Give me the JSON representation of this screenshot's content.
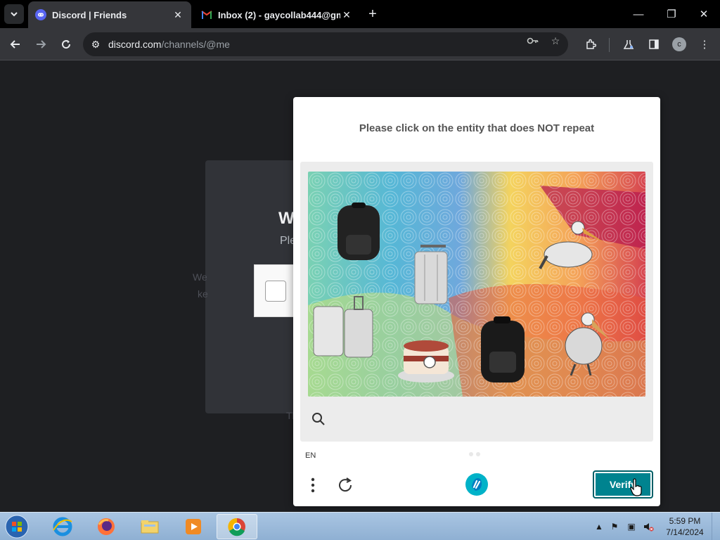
{
  "browser": {
    "tabs": [
      {
        "title": "Discord | Friends",
        "icon": "discord-icon",
        "active": true
      },
      {
        "title": "Inbox (2) - gaycollab444@gma",
        "icon": "gmail-icon",
        "active": false
      }
    ],
    "url": {
      "host": "discord.com",
      "path": "/channels/@me"
    },
    "profile_initial": "c"
  },
  "discord_bg": {
    "heading": "W",
    "subtext": "Ple",
    "left_line1": "We",
    "left_line2": "ke",
    "bottom_text": "Th"
  },
  "captcha": {
    "prompt": "Please click on the entity that does NOT repeat",
    "language": "EN",
    "verify_label": "Verify",
    "image_objects": [
      "backpack",
      "suitcase",
      "pelican",
      "suitcase",
      "cake",
      "backpack",
      "pelican"
    ],
    "colors": {
      "verify": "#00838f",
      "logo": "#00b2c8"
    }
  },
  "taskbar": {
    "apps": [
      "internet-explorer-icon",
      "firefox-icon",
      "file-explorer-icon",
      "media-player-icon",
      "chrome-icon"
    ],
    "clock_time": "5:59 PM",
    "clock_date": "7/14/2024"
  }
}
